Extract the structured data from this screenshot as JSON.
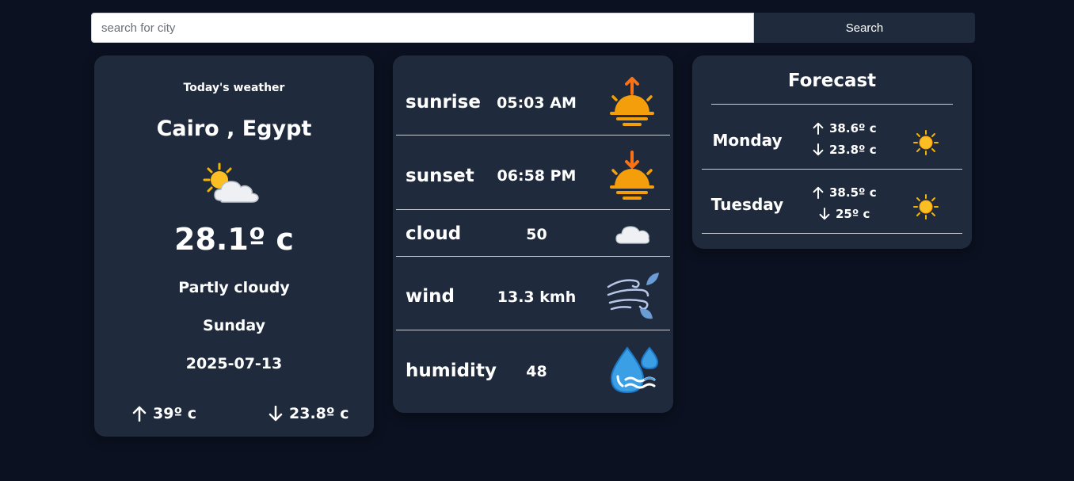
{
  "search": {
    "placeholder": "search for city",
    "value": "",
    "button_label": "Search"
  },
  "today": {
    "label": "Today's weather",
    "city": "Cairo , Egypt",
    "icon": "sun-behind-cloud-icon",
    "temperature": "28.1º c",
    "condition": "Partly cloudy",
    "day": "Sunday",
    "date": "2025-07-13",
    "max": "39º c",
    "min": "23.8º c"
  },
  "details": [
    {
      "label": "sunrise",
      "value": "05:03 AM",
      "icon": "sunrise-icon"
    },
    {
      "label": "sunset",
      "value": "06:58 PM",
      "icon": "sunset-icon"
    },
    {
      "label": "cloud",
      "value": "50",
      "icon": "cloud-icon"
    },
    {
      "label": "wind",
      "value": "13.3 kmh",
      "icon": "wind-icon"
    },
    {
      "label": "humidity",
      "value": "48",
      "icon": "droplet-icon"
    }
  ],
  "forecast": {
    "title": "Forecast",
    "days": [
      {
        "day": "Monday",
        "max": "38.6º c",
        "min": "23.8º c",
        "icon": "sun-icon"
      },
      {
        "day": "Tuesday",
        "max": "38.5º c",
        "min": "25º c",
        "icon": "sun-icon"
      }
    ]
  },
  "colors": {
    "background": "#0b1120",
    "card": "#1f2a3c",
    "sun_orange": "#f59e0b",
    "sun_yellow": "#fbbf24",
    "water_blue": "#3b9fe6"
  }
}
